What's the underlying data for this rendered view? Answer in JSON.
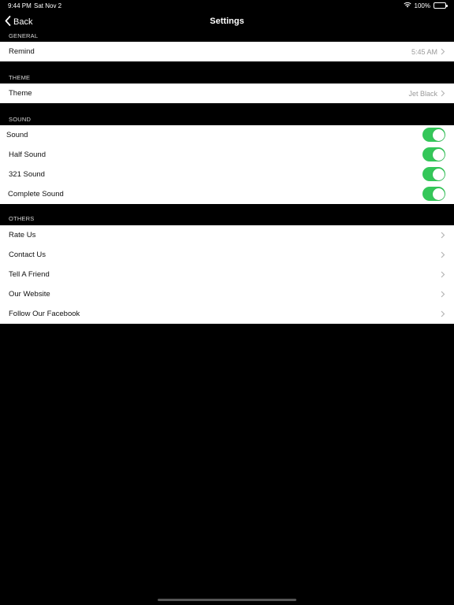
{
  "status_bar": {
    "time": "9:44 PM",
    "date": "Sat Nov 2",
    "battery": "100%"
  },
  "nav": {
    "back_label": "Back",
    "title": "Settings"
  },
  "sections": {
    "general": {
      "header": "GENERAL",
      "remind": {
        "label": "Remind",
        "value": "5:45 AM"
      }
    },
    "theme": {
      "header": "THEME",
      "theme": {
        "label": "Theme",
        "value": "Jet Black"
      }
    },
    "sound": {
      "header": "SOUND",
      "items": [
        {
          "label": "Sound",
          "on": true
        },
        {
          "label": "Half Sound",
          "on": true
        },
        {
          "label": "321 Sound",
          "on": true
        },
        {
          "label": "Complete Sound",
          "on": true
        }
      ]
    },
    "others": {
      "header": "OTHERS",
      "items": [
        {
          "label": "Rate Us"
        },
        {
          "label": "Contact Us"
        },
        {
          "label": "Tell A Friend"
        },
        {
          "label": "Our Website"
        },
        {
          "label": "Follow Our Facebook"
        }
      ]
    }
  },
  "colors": {
    "toggle_on": "#34c759",
    "background": "#000000",
    "row_background": "#ffffff"
  }
}
